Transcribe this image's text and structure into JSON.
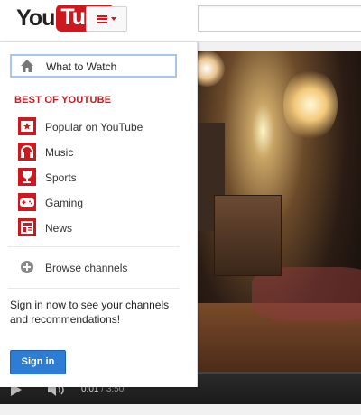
{
  "header": {
    "logo_you": "You",
    "logo_tube": "Tube",
    "guide_button_icon": "menu-icon",
    "search_placeholder": ""
  },
  "guide": {
    "what_to_watch": "What to Watch",
    "section_title": "BEST OF YOUTUBE",
    "items": [
      {
        "label": "Popular on YouTube",
        "icon": "popular-icon"
      },
      {
        "label": "Music",
        "icon": "headphones-icon"
      },
      {
        "label": "Sports",
        "icon": "trophy-icon"
      },
      {
        "label": "Gaming",
        "icon": "gamepad-icon"
      },
      {
        "label": "News",
        "icon": "newspaper-icon"
      }
    ],
    "browse_channels": "Browse channels",
    "signin_text": "Sign in now to see your channels and recommendations!",
    "signin_button": "Sign in"
  },
  "player": {
    "current_time": "0:01",
    "separator": " / ",
    "duration": "3:50"
  },
  "colors": {
    "brand_red": "#cc181e",
    "signin_blue": "#2c7dd3",
    "focus_border": "#a8c6e8"
  }
}
